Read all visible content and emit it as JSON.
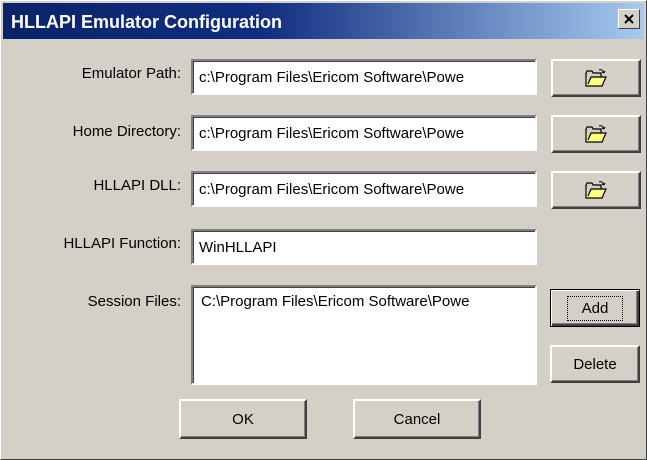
{
  "window": {
    "title": "HLLAPI Emulator Configuration"
  },
  "fields": {
    "emulator_path": {
      "label": "Emulator Path:",
      "value": "c:\\Program Files\\Ericom Software\\Powe"
    },
    "home_directory": {
      "label": "Home Directory:",
      "value": "c:\\Program Files\\Ericom Software\\Powe"
    },
    "hllapi_dll": {
      "label": "HLLAPI DLL:",
      "value": "c:\\Program Files\\Ericom Software\\Powe"
    },
    "hllapi_function": {
      "label": "HLLAPI Function:",
      "value": "WinHLLAPI"
    }
  },
  "session_files": {
    "label": "Session Files:",
    "items": [
      "C:\\Program Files\\Ericom Software\\Powe"
    ]
  },
  "buttons": {
    "add": "Add",
    "delete": "Delete",
    "ok": "OK",
    "cancel": "Cancel"
  },
  "icons": {
    "browse": "folder-open-icon",
    "close": "close-icon"
  },
  "colors": {
    "title_start": "#0a246a",
    "title_end": "#a6caf0",
    "face": "#d4d0c8"
  }
}
